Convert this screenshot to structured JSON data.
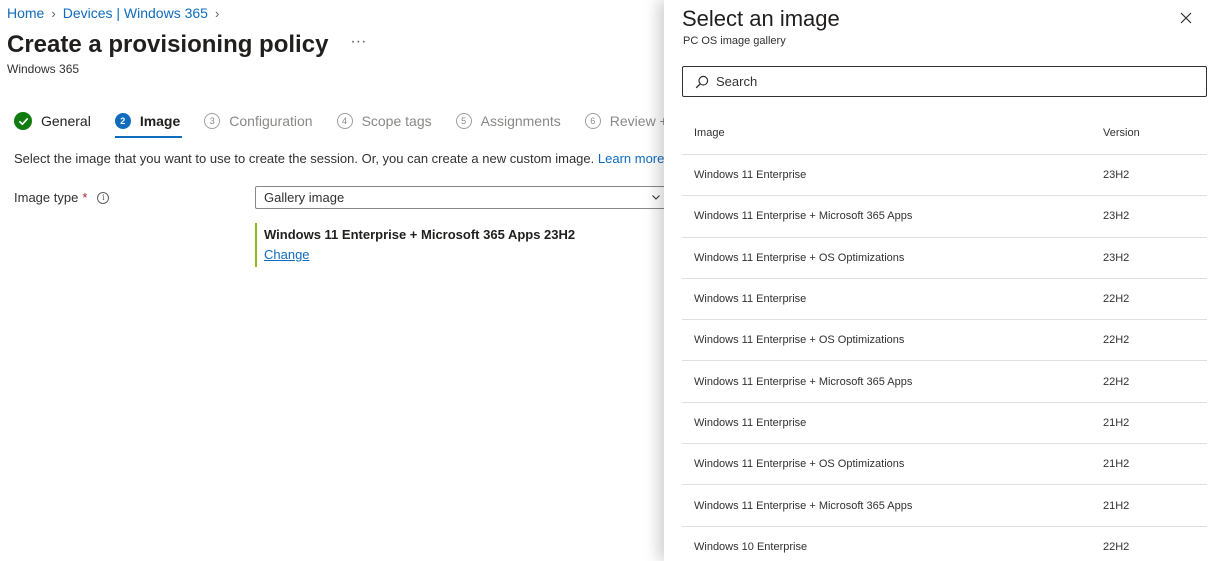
{
  "breadcrumb": {
    "items": [
      "Home",
      "Devices | Windows 365"
    ]
  },
  "page": {
    "title": "Create a provisioning policy",
    "more_label": "···",
    "subtitle": "Windows 365"
  },
  "steps": [
    {
      "number": "1",
      "label": "General",
      "state": "done"
    },
    {
      "number": "2",
      "label": "Image",
      "state": "active"
    },
    {
      "number": "3",
      "label": "Configuration",
      "state": "pending"
    },
    {
      "number": "4",
      "label": "Scope tags",
      "state": "pending"
    },
    {
      "number": "5",
      "label": "Assignments",
      "state": "pending"
    },
    {
      "number": "6",
      "label": "Review + c",
      "state": "pending"
    }
  ],
  "instructions": {
    "text": "Select the image that you want to use to create the session. Or, you can create a new custom image.",
    "link": "Learn more"
  },
  "image_type": {
    "label": "Image type",
    "required_mark": "*",
    "info_icon": "i",
    "value": "Gallery image"
  },
  "selected_image": {
    "name": "Windows 11 Enterprise + Microsoft 365 Apps 23H2",
    "change_label": "Change"
  },
  "panel": {
    "title": "Select an image",
    "subtitle": "PC OS image gallery",
    "search_placeholder": "Search",
    "columns": {
      "image": "Image",
      "version": "Version"
    },
    "rows": [
      {
        "image": "Windows 11 Enterprise",
        "version": "23H2"
      },
      {
        "image": "Windows 11 Enterprise + Microsoft 365 Apps",
        "version": "23H2"
      },
      {
        "image": "Windows 11 Enterprise + OS Optimizations",
        "version": "23H2"
      },
      {
        "image": "Windows 11 Enterprise",
        "version": "22H2"
      },
      {
        "image": "Windows 11 Enterprise + OS Optimizations",
        "version": "22H2"
      },
      {
        "image": "Windows 11 Enterprise + Microsoft 365 Apps",
        "version": "22H2"
      },
      {
        "image": "Windows 11 Enterprise",
        "version": "21H2"
      },
      {
        "image": "Windows 11 Enterprise + OS Optimizations",
        "version": "21H2"
      },
      {
        "image": "Windows 11 Enterprise + Microsoft 365 Apps",
        "version": "21H2"
      },
      {
        "image": "Windows 10 Enterprise",
        "version": "22H2"
      }
    ]
  },
  "colors": {
    "accent": "#0f6cbd",
    "success": "#107c10",
    "selected_bar": "#8cbd18",
    "required": "#a4262c"
  }
}
